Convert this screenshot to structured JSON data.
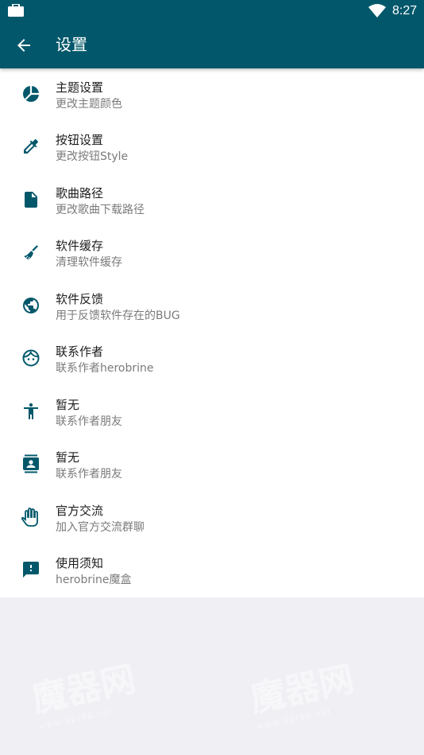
{
  "status": {
    "time": "8:27"
  },
  "appbar": {
    "title": "设置"
  },
  "items": [
    {
      "title": "主题设置",
      "subtitle": "更改主题颜色",
      "icon": "palette-icon"
    },
    {
      "title": "按钮设置",
      "subtitle": "更改按钮Style",
      "icon": "eyedropper-icon"
    },
    {
      "title": "歌曲路径",
      "subtitle": "更改歌曲下载路径",
      "icon": "file-icon"
    },
    {
      "title": "软件缓存",
      "subtitle": "清理软件缓存",
      "icon": "broom-icon"
    },
    {
      "title": "软件反馈",
      "subtitle": "用于反馈软件存在的BUG",
      "icon": "globe-icon"
    },
    {
      "title": "联系作者",
      "subtitle": "联系作者herobrine",
      "icon": "face-icon"
    },
    {
      "title": "暂无",
      "subtitle": "联系作者朋友",
      "icon": "accessibility-icon"
    },
    {
      "title": "暂无",
      "subtitle": "联系作者朋友",
      "icon": "contact-card-icon"
    },
    {
      "title": "官方交流",
      "subtitle": "加入官方交流群聊",
      "icon": "hand-icon"
    },
    {
      "title": "使用须知",
      "subtitle": "herobrine魔盒",
      "icon": "feedback-icon"
    }
  ],
  "watermark": {
    "text": "魔器网",
    "url": "www.32r46.net"
  },
  "colors": {
    "primary": "#02586a",
    "icon": "#02586a",
    "background": "#efeff4"
  }
}
